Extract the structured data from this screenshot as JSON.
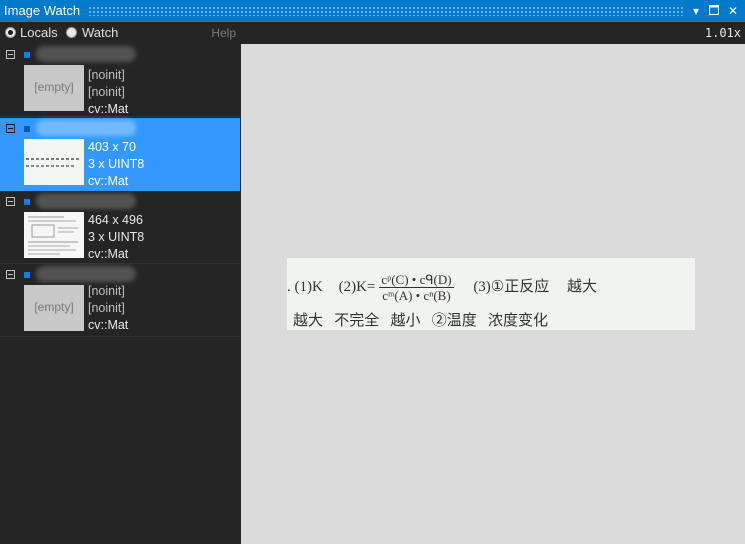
{
  "window": {
    "title": "Image Watch"
  },
  "toolbar": {
    "locals_label": "Locals",
    "watch_label": "Watch",
    "help_label": "Help",
    "selected": "Locals"
  },
  "viewer": {
    "zoom": "1.01x"
  },
  "items": [
    {
      "line1": "[empty]",
      "line2": "[noinit]",
      "line3": "[noinit]",
      "line4": "cv::Mat",
      "thumb_text": "[empty]",
      "selected": false
    },
    {
      "line2": "403 x 70",
      "line3": "3 x UINT8",
      "line4": "cv::Mat",
      "selected": true
    },
    {
      "line2": "464 x 496",
      "line3": "3 x UINT8",
      "line4": "cv::Mat",
      "selected": false
    },
    {
      "line2": "[noinit]",
      "line3": "[noinit]",
      "line4": "cv::Mat",
      "thumb_text": "[empty]",
      "selected": false
    }
  ],
  "image_content": {
    "line1_prefix": ". (1)K",
    "line1_part2": "(2)K=",
    "frac_num": "cᵖ(C) • cᑫ(D)",
    "frac_den": "cᵐ(A) • cⁿ(B)",
    "line1_part3": "(3)①正反应",
    "line1_part4": "越大",
    "line2": "越大   不完全   越小   ②温度   浓度变化"
  }
}
